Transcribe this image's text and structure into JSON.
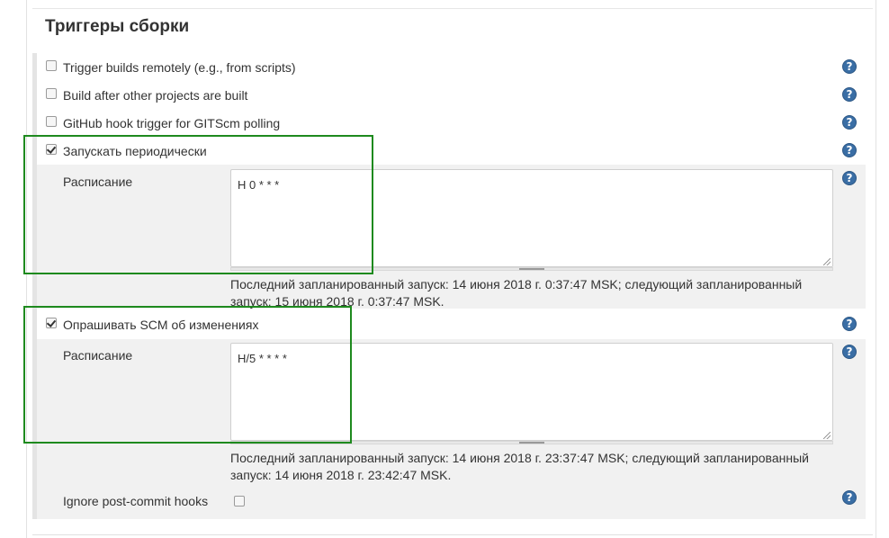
{
  "section": {
    "title": "Триггеры сборки"
  },
  "triggers": {
    "remote": {
      "label": "Trigger builds remotely (e.g., from scripts)",
      "checked": false
    },
    "after_other": {
      "label": "Build after other projects are built",
      "checked": false
    },
    "github_hook": {
      "label": "GitHub hook trigger for GITScm polling",
      "checked": false
    },
    "periodic": {
      "label": "Запускать периодически",
      "checked": true,
      "schedule_label": "Расписание",
      "schedule_value": "H 0 * * *",
      "info": "Последний запланированный запуск: 14 июня 2018 г. 0:37:47 MSK; следующий запланированный запуск: 15 июня 2018 г. 0:37:47 MSK."
    },
    "poll_scm": {
      "label": "Опрашивать SCM об изменениях",
      "checked": true,
      "schedule_label": "Расписание",
      "schedule_value": "H/5 * * * *",
      "info": "Последний запланированный запуск: 14 июня 2018 г. 23:37:47 MSK; следующий запланированный запуск: 14 июня 2018 г. 23:42:47 MSK.",
      "ignore_hooks_label": "Ignore post-commit hooks",
      "ignore_hooks_checked": false
    }
  },
  "help_icon_glyph": "?",
  "colors": {
    "highlight_box": "#1e8a1e",
    "help_icon": "#3a6ea5"
  }
}
